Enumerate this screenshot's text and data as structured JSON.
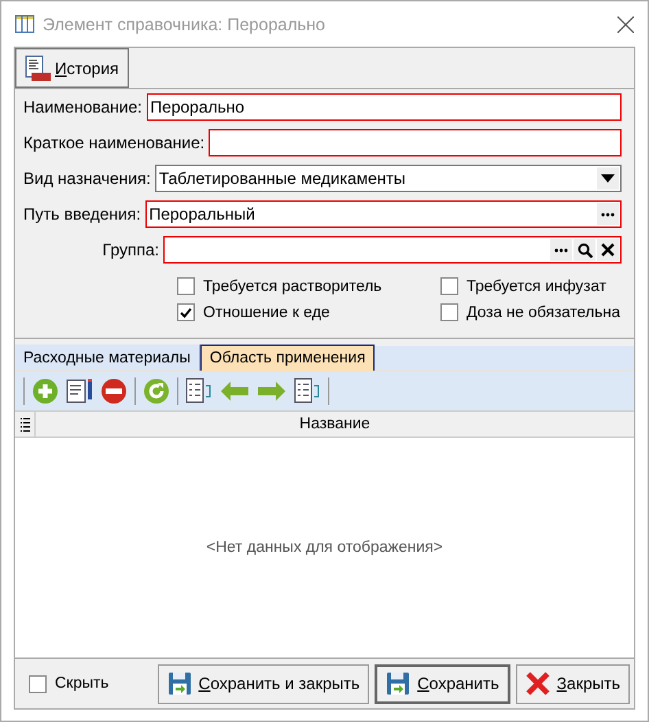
{
  "window": {
    "title": "Элемент справочника: Перорально"
  },
  "toolbar": {
    "history_button": "История"
  },
  "fields": [
    {
      "label": "Наименование:",
      "kind": "text",
      "value": "Перорально",
      "required": true
    },
    {
      "label": "Краткое наименование:",
      "kind": "text",
      "required": true
    },
    {
      "label": "Вид назначения:",
      "kind": "dropdown",
      "value": "Таблетированные медикаменты",
      "required": false
    },
    {
      "label": "Путь введения:",
      "kind": "lookup",
      "value": "Пероральный",
      "required": true
    },
    {
      "label": "Группа:",
      "kind": "lookup-full",
      "required": true
    }
  ],
  "checkboxes": [
    {
      "label": "Требуется растворитель",
      "checked": false
    },
    {
      "label": "Требуется инфузат",
      "checked": false
    },
    {
      "label": "Отношение к еде",
      "checked": true
    },
    {
      "label": "Доза не обязательна",
      "checked": false
    }
  ],
  "tabs": [
    {
      "label": "Расходные материалы",
      "selected": false
    },
    {
      "label": "Область применения",
      "selected": true
    }
  ],
  "grid": {
    "columns": [
      "Название"
    ],
    "empty_text": "<Нет данных для отображения>"
  },
  "footer": {
    "hide_checkbox": {
      "label": "Скрыть",
      "checked": false
    },
    "buttons": [
      {
        "label": "Сохранить и закрыть",
        "kind": "save-close"
      },
      {
        "label": "Сохранить",
        "kind": "save"
      },
      {
        "label": "Закрыть",
        "kind": "close"
      }
    ]
  }
}
